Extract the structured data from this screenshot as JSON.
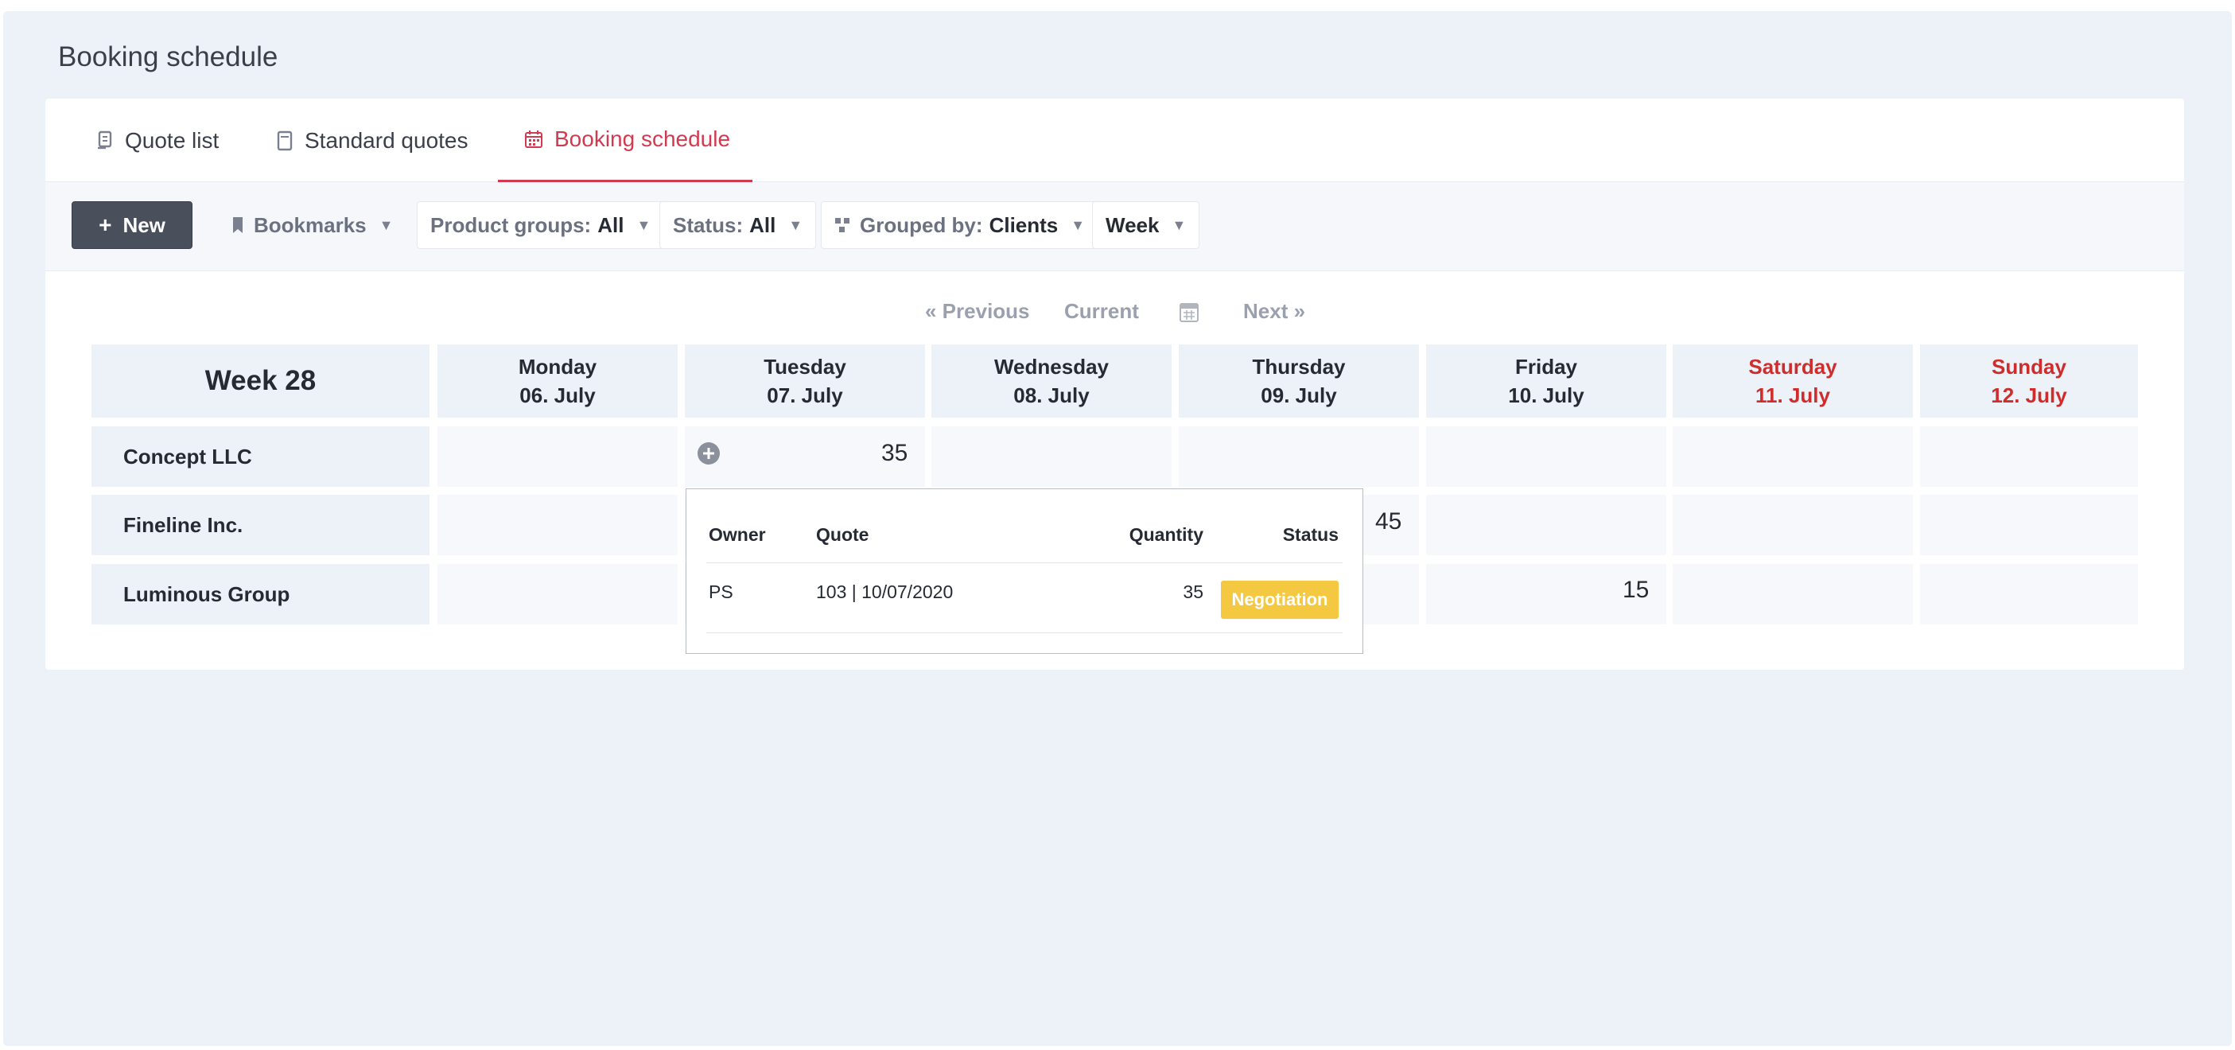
{
  "page": {
    "title": "Booking schedule"
  },
  "tabs": [
    {
      "label": "Quote list",
      "icon": "quote-list-icon"
    },
    {
      "label": "Standard quotes",
      "icon": "document-icon"
    },
    {
      "label": "Booking schedule",
      "icon": "calendar-icon",
      "active": true
    }
  ],
  "toolbar": {
    "new_label": "New",
    "bookmarks_label": "Bookmarks",
    "product_groups": {
      "label": "Product groups:",
      "value": "All"
    },
    "status": {
      "label": "Status:",
      "value": "All"
    },
    "grouped_by": {
      "label": "Grouped by:",
      "value": "Clients"
    },
    "period": "Week"
  },
  "nav": {
    "previous": "« Previous",
    "current": "Current",
    "next": "Next »"
  },
  "schedule": {
    "week_label": "Week 28",
    "days": [
      {
        "name": "Monday",
        "date": "06. July",
        "weekend": false
      },
      {
        "name": "Tuesday",
        "date": "07. July",
        "weekend": false
      },
      {
        "name": "Wednesday",
        "date": "08. July",
        "weekend": false
      },
      {
        "name": "Thursday",
        "date": "09. July",
        "weekend": false
      },
      {
        "name": "Friday",
        "date": "10. July",
        "weekend": false
      },
      {
        "name": "Saturday",
        "date": "11. July",
        "weekend": true
      },
      {
        "name": "Sunday",
        "date": "12. July",
        "weekend": true
      }
    ],
    "rows": [
      {
        "client": "Concept LLC",
        "values": [
          "",
          "35",
          "",
          "",
          "",
          "",
          ""
        ]
      },
      {
        "client": "Fineline Inc.",
        "values": [
          "",
          "",
          "",
          "45",
          "",
          "",
          ""
        ]
      },
      {
        "client": "Luminous Group",
        "values": [
          "",
          "",
          "",
          "",
          "15",
          "",
          ""
        ]
      }
    ]
  },
  "popup": {
    "headers": {
      "owner": "Owner",
      "quote": "Quote",
      "quantity": "Quantity",
      "status": "Status"
    },
    "row": {
      "owner": "PS",
      "quote": "103 | 10/07/2020",
      "quantity": "35",
      "status": "Negotiation"
    }
  },
  "colors": {
    "accent": "#d23a4f",
    "weekend": "#cf2c2c",
    "badge": "#f5c842",
    "new_button": "#4a4f5c"
  }
}
